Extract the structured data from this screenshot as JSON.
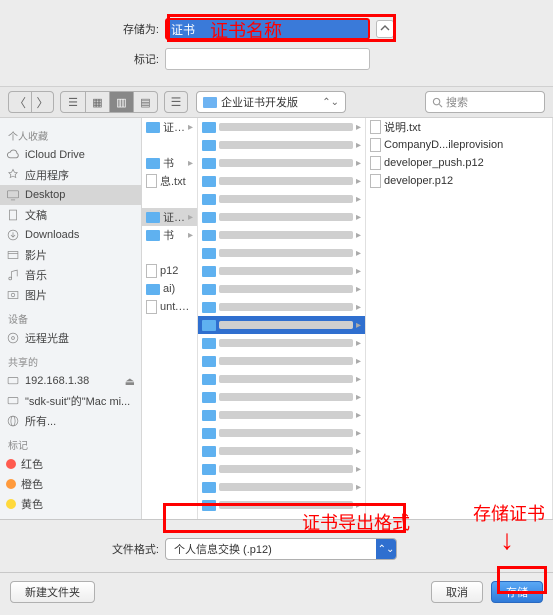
{
  "fields": {
    "saveas_label": "存储为:",
    "saveas_value": "证书",
    "tags_label": "标记:",
    "tags_value": ""
  },
  "annotations": {
    "name": "证书名称",
    "format": "证书导出格式",
    "save": "存储证书"
  },
  "toolbar": {
    "path": "企业证书开发版",
    "search_placeholder": "搜索"
  },
  "sidebar": {
    "favorites_header": "个人收藏",
    "favorites": [
      {
        "label": "iCloud Drive",
        "icon": "cloud"
      },
      {
        "label": "应用程序",
        "icon": "app"
      },
      {
        "label": "Desktop",
        "icon": "desktop",
        "selected": true
      },
      {
        "label": "文稿",
        "icon": "doc"
      },
      {
        "label": "Downloads",
        "icon": "download"
      },
      {
        "label": "影片",
        "icon": "movie"
      },
      {
        "label": "音乐",
        "icon": "music"
      },
      {
        "label": "图片",
        "icon": "photo"
      }
    ],
    "devices_header": "设备",
    "devices": [
      {
        "label": "远程光盘",
        "icon": "disc"
      }
    ],
    "shared_header": "共享的",
    "shared": [
      {
        "label": "192.168.1.38",
        "icon": "display",
        "eject": true
      },
      {
        "label": "\"sdk-suit\"的\"Mac mi...",
        "icon": "display"
      },
      {
        "label": "所有...",
        "icon": "globe"
      }
    ],
    "tags_header": "标记",
    "tags": [
      {
        "label": "红色",
        "color": "#ff5b4f"
      },
      {
        "label": "橙色",
        "color": "#ff9a3c"
      },
      {
        "label": "黄色",
        "color": "#ffd93c"
      }
    ]
  },
  "col1": [
    {
      "label": "证书",
      "type": "folder",
      "arrow": true
    },
    {
      "label": "",
      "type": "gap"
    },
    {
      "label": "书",
      "type": "folder",
      "arrow": true
    },
    {
      "label": "息.txt",
      "type": "doc"
    },
    {
      "label": "",
      "type": "gap"
    },
    {
      "label": "证书",
      "type": "folder",
      "arrow": true,
      "sel": true
    },
    {
      "label": "书",
      "type": "folder",
      "arrow": true
    },
    {
      "label": "",
      "type": "gap"
    },
    {
      "label": "p12",
      "type": "doc"
    },
    {
      "label": "ai)",
      "type": "folder"
    },
    {
      "label": "unt.cer",
      "type": "doc"
    }
  ],
  "col3": [
    {
      "label": "说明.txt",
      "type": "doc"
    },
    {
      "label": "CompanyD...ileprovision",
      "type": "doc"
    },
    {
      "label": "developer_push.p12",
      "type": "doc"
    },
    {
      "label": "developer.p12",
      "type": "doc"
    }
  ],
  "format": {
    "label": "文件格式:",
    "value": "个人信息交换 (.p12)"
  },
  "footer": {
    "newfolder": "新建文件夹",
    "cancel": "取消",
    "save": "存储"
  }
}
